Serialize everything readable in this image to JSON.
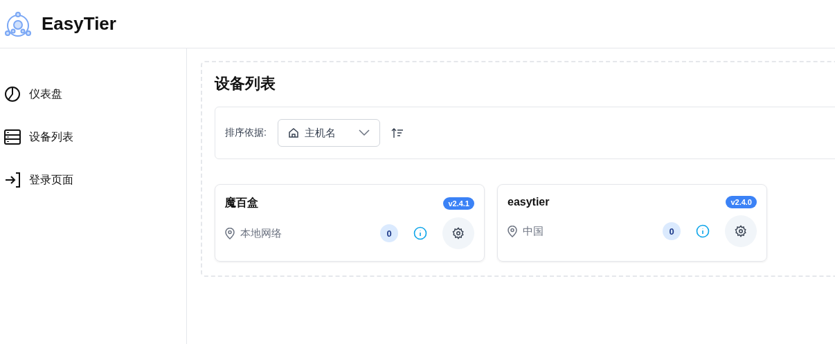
{
  "app": {
    "title": "EasyTier"
  },
  "sidebar": {
    "items": [
      {
        "label": "仪表盘",
        "kind": "dashboard"
      },
      {
        "label": "设备列表",
        "kind": "devices"
      },
      {
        "label": "登录页面",
        "kind": "login"
      }
    ]
  },
  "page": {
    "title": "设备列表"
  },
  "sort": {
    "label": "排序依据:",
    "value": "主机名"
  },
  "devices": [
    {
      "name": "魔百盒",
      "version": "v2.4.1",
      "location": "本地网络",
      "count": "0"
    },
    {
      "name": "easytier",
      "version": "v2.4.0",
      "location": "中国",
      "count": "0"
    }
  ]
}
